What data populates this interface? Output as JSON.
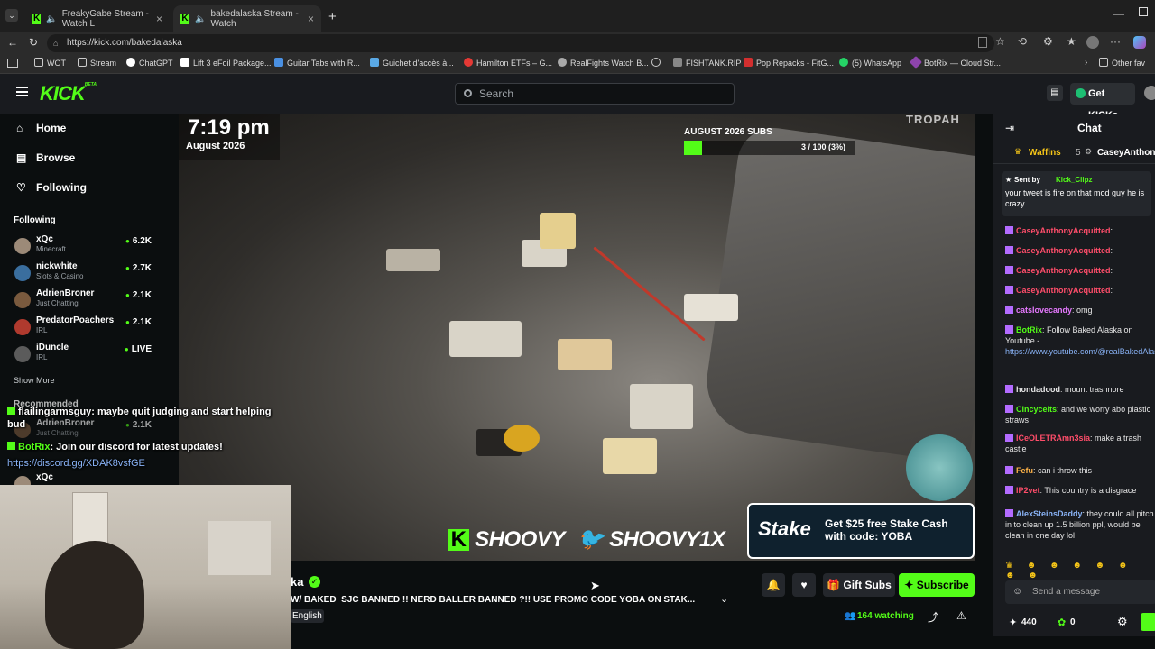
{
  "browser": {
    "tabs": [
      {
        "label": "FreakyGabe Stream - Watch L"
      },
      {
        "label": "bakedalaska Stream - Watch"
      }
    ],
    "url": "https://kick.com/bakedalaska",
    "bookmarks": [
      "WOT",
      "Stream",
      "ChatGPT",
      "Lift 3 eFoil Package...",
      "Guitar Tabs with R...",
      "Guichet d'accès à...",
      "Hamilton ETFs – G...",
      "RealFights Watch B...",
      "",
      "FISHTANK.RIP",
      "Pop Repacks - FitG...",
      "(5) WhatsApp",
      "BotRix — Cloud Str...",
      "Other fav"
    ]
  },
  "kick": {
    "logo": "KICK",
    "logo_badge": "BETA",
    "search_placeholder": "Search",
    "get_kicks": "Get KICKs"
  },
  "sidebar": {
    "nav": [
      {
        "label": "Home",
        "icon": "home-icon"
      },
      {
        "label": "Browse",
        "icon": "browse-icon"
      },
      {
        "label": "Following",
        "icon": "heart-icon"
      }
    ],
    "following_title": "Following",
    "channels": [
      {
        "name": "xQc",
        "category": "Minecraft",
        "viewers": "6.2K"
      },
      {
        "name": "nickwhite",
        "category": "Slots & Casino",
        "viewers": "2.7K"
      },
      {
        "name": "AdrienBroner",
        "category": "Just Chatting",
        "viewers": "2.1K"
      },
      {
        "name": "PredatorPoachers",
        "category": "IRL",
        "viewers": "2.1K"
      },
      {
        "name": "iDuncle",
        "category": "IRL",
        "viewers": "LIVE"
      }
    ],
    "show_more": "Show More",
    "recommended_title": "Recommended",
    "recommended": [
      {
        "name": "AdrienBroner",
        "category": "Just Chatting",
        "viewers": "2.1K"
      },
      {
        "name": "xQc",
        "category": "",
        "viewers": ""
      }
    ]
  },
  "video": {
    "time": "7:19 pm",
    "date": "August 2026",
    "watermark": "TROPAH",
    "subgoal_title": "AUGUST 2026 SUBS",
    "subgoal_progress": "3 / 100 (3%)",
    "subgoal_fraction": 0.03,
    "shoovy_left": "SHOOVY",
    "shoovy_right": "SHOOVY1X",
    "stake_logo": "Stake",
    "stake_text": "Get $25 free Stake Cash with code: YOBA"
  },
  "overlay_chat": [
    {
      "user": "flailingarmsguy",
      "text": ": maybe quit judging and start helping bud"
    },
    {
      "user": "BotRix",
      "text": ": Join our discord for latest updates!"
    },
    {
      "user": "",
      "text": "https://discord.gg/XDAK8vsfGE"
    }
  ],
  "stream_info": {
    "channel_partial": "ka",
    "title": "W/ BAKED  SJC BANNED !! NERD BALLER BANNED ?!!  USE PROMO CODE YOBA ON STAK...",
    "language": "English",
    "gift_subs": "Gift Subs",
    "subscribe": "Subscribe",
    "watching": "164 watching"
  },
  "chat": {
    "title": "Chat",
    "pinned_users": [
      {
        "name": "Waffins",
        "count": "5"
      },
      {
        "name": "CaseyAnthony"
      }
    ],
    "pinned_sent_by": "Sent by",
    "pinned_author": "Kick_Clipz",
    "pinned_text": "your tweet is fire on that mod guy he is crazy",
    "messages": [
      {
        "user": "CaseyAnthonyAcquitted",
        "text": ":",
        "color": "#ff4d6a"
      },
      {
        "user": "CaseyAnthonyAcquitted",
        "text": ":",
        "color": "#ff4d6a"
      },
      {
        "user": "CaseyAnthonyAcquitted",
        "text": ":",
        "color": "#ff4d6a"
      },
      {
        "user": "CaseyAnthonyAcquitted",
        "text": ":",
        "color": "#ff4d6a"
      },
      {
        "user": "catslovecandy",
        "text": ": omg",
        "color": "#e679ff"
      },
      {
        "user": "BotRix",
        "text": ": Follow Baked Alaska on Youtube -",
        "color": "#53fc18"
      },
      {
        "user": "",
        "text": "https://www.youtube.com/@realBakedAlaska",
        "color": "#8ab4f8"
      },
      {
        "user": "hondadood",
        "text": ": mount trashnore",
        "color": "#e6e6e6"
      },
      {
        "user": "Cincycelts",
        "text": ": and we worry abo plastic straws",
        "color": "#53fc18"
      },
      {
        "user": "ICeOLETRAmn3sia",
        "text": ": make a trash castle",
        "color": "#ff4d6a"
      },
      {
        "user": "Fefu",
        "text": ": can i throw this",
        "color": "#ffb347"
      },
      {
        "user": "IP2vet",
        "text": ": This country is a disgrace",
        "color": "#ff4d6a"
      },
      {
        "user": "AlexSteinsDaddy",
        "text": ": they could all pitch in to clean up 1.5 billion ppl, would be clean in one day lol",
        "color": "#8ab4f8"
      }
    ],
    "input_placeholder": "Send a message",
    "kicks_count": "440",
    "points": "0"
  },
  "colors": {
    "kick_green": "#53fc18",
    "chat_bg": "#191b1f",
    "page_bg": "#0b0e0f"
  }
}
